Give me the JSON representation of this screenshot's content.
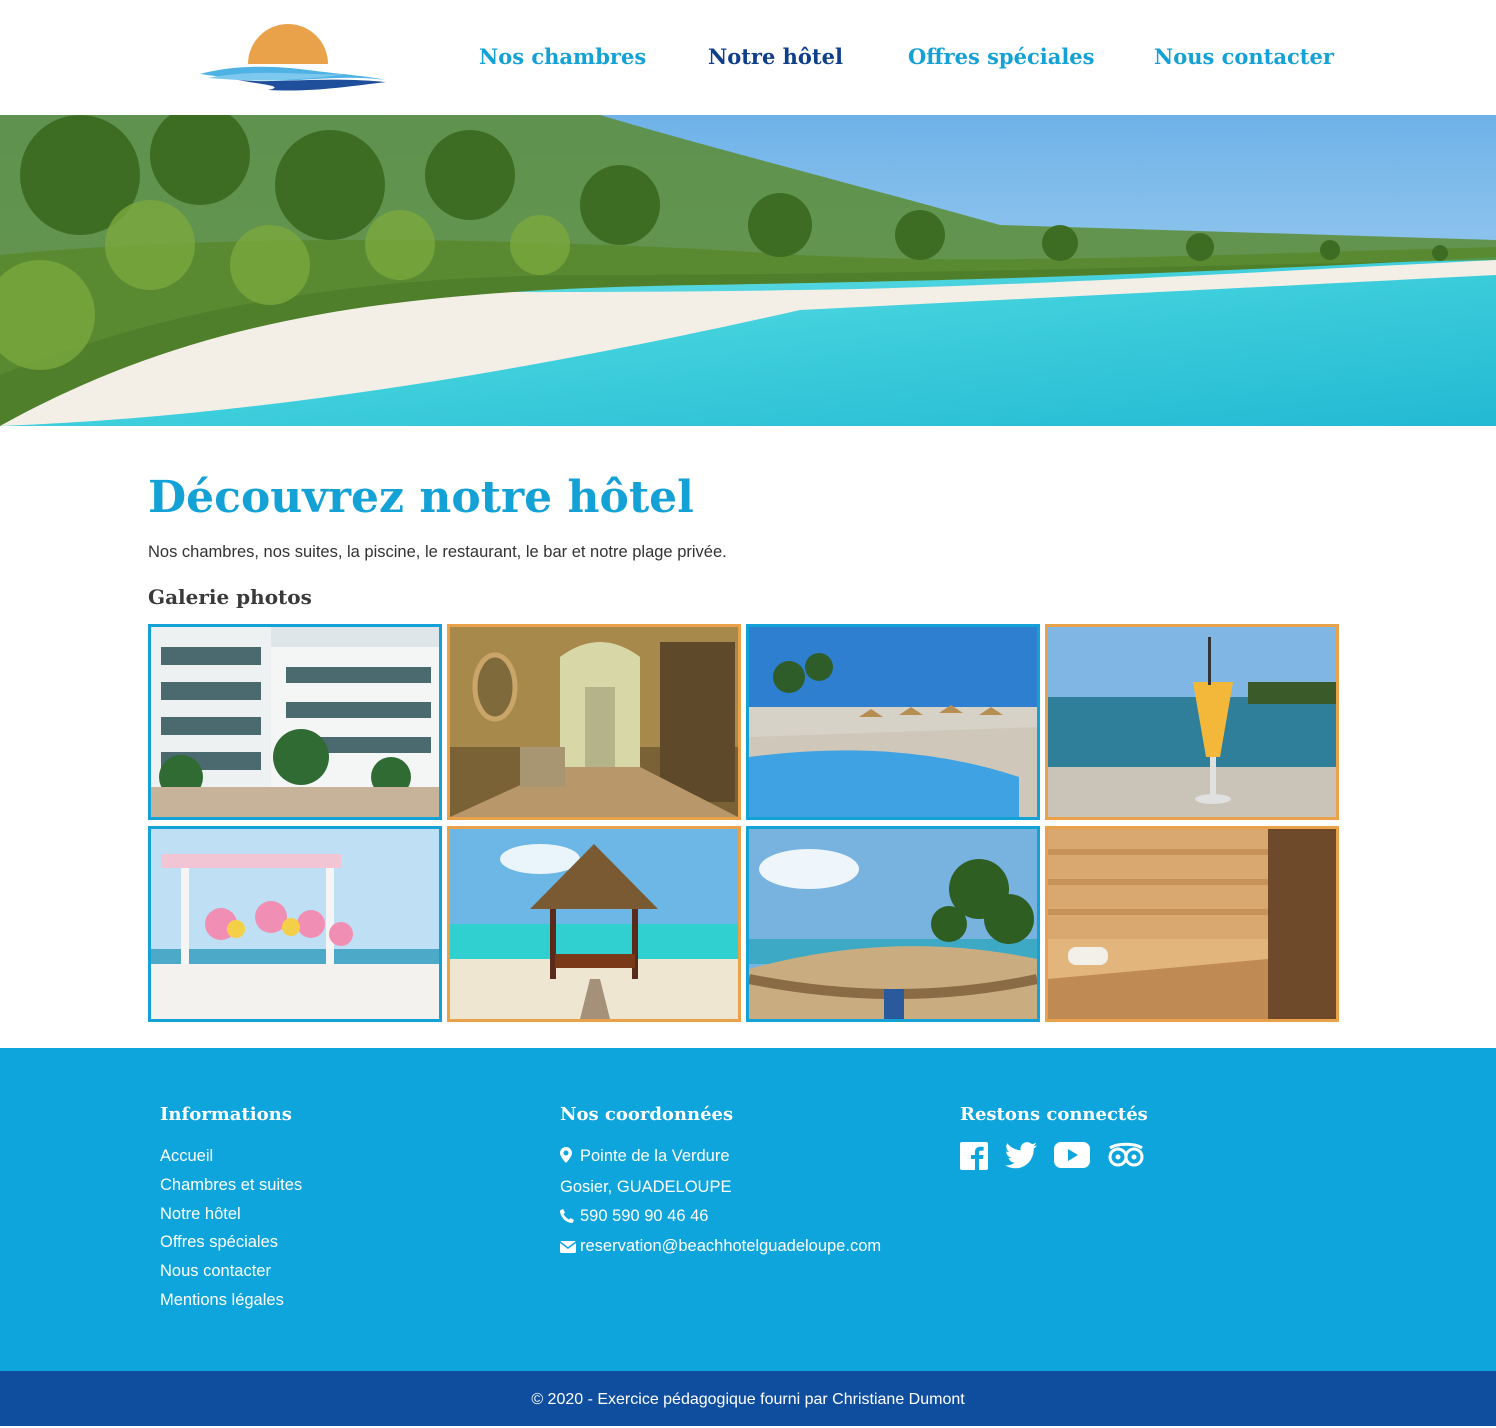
{
  "header": {
    "nav": [
      {
        "label": "Nos chambres",
        "active": false
      },
      {
        "label": "Notre hôtel",
        "active": true
      },
      {
        "label": "Offres spéciales",
        "active": false
      },
      {
        "label": "Nous contacter",
        "active": false
      }
    ]
  },
  "main": {
    "title": "Découvrez notre hôtel",
    "intro": "Nos chambres, nos suites, la piscine, le restaurant, le bar et notre plage privée.",
    "gallery_title": "Galerie photos",
    "gallery": [
      {
        "subject": "hotel-building",
        "border": "#14a2d6"
      },
      {
        "subject": "lobby-hallway",
        "border": "#e9a24a"
      },
      {
        "subject": "pool",
        "border": "#14a2d6"
      },
      {
        "subject": "cocktail-drink",
        "border": "#e9a24a"
      },
      {
        "subject": "wedding-table",
        "border": "#14a2d6"
      },
      {
        "subject": "beach-gazebo",
        "border": "#e9a24a"
      },
      {
        "subject": "hammock",
        "border": "#14a2d6"
      },
      {
        "subject": "sauna",
        "border": "#e9a24a"
      }
    ]
  },
  "footer": {
    "informations": {
      "title": "Informations",
      "links": [
        "Accueil",
        "Chambres et suites",
        "Notre hôtel",
        "Offres spéciales",
        "Nous contacter",
        "Mentions légales"
      ]
    },
    "contact": {
      "title": "Nos coordonnées",
      "address_line1": "Pointe de la Verdure",
      "address_line2": "Gosier, GUADELOUPE",
      "phone": "590 590 90 46 46",
      "email": "reservation@beachhotelguadeloupe.com"
    },
    "social": {
      "title": "Restons connectés",
      "icons": [
        "facebook-icon",
        "twitter-icon",
        "youtube-icon",
        "tripadvisor-icon"
      ]
    }
  },
  "copyright": "© 2020 - Exercice pédagogique fourni par Christiane Dumont",
  "colors": {
    "accent": "#14a2d6",
    "active_nav": "#0f3f8a",
    "footer_bg": "#0ea5dc",
    "copyright_bg": "#0f4e9e",
    "orange": "#e9a24a"
  }
}
